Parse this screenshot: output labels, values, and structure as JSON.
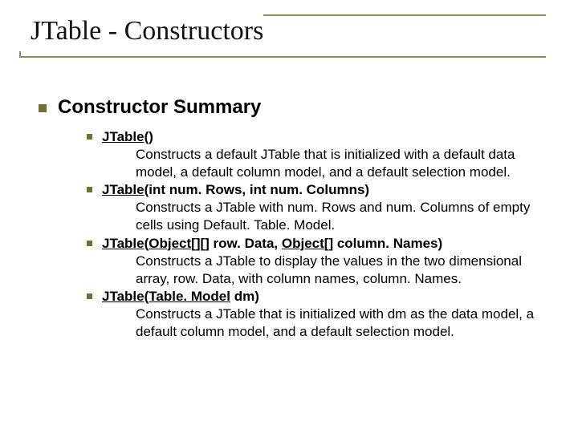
{
  "title": "JTable - Constructors",
  "section_heading": "Constructor Summary",
  "constructors": [
    {
      "name": "JTable",
      "params_html": "()",
      "description": "Constructs a default JTable that is initialized with a default data model, a default column model, and a default selection model."
    },
    {
      "name": "JTable",
      "params_html": "(int num. Rows, int num. Columns)",
      "description": "Constructs a JTable with num. Rows and num. Columns of empty cells using Default. Table. Model."
    },
    {
      "name": "JTable",
      "params_html": "(OBJLINK[][] row. Data, OBJLINK[] column. Names)",
      "obj_link_text": "Object",
      "description": "Constructs a JTable to display the values in the two dimensional array, row. Data, with column names, column. Names."
    },
    {
      "name": "JTable",
      "params_html": "(TMLINK dm)",
      "tm_link_text": "Table. Model",
      "description": "Constructs a JTable that is initialized with dm as the data model, a default column model, and a default selection model."
    }
  ]
}
